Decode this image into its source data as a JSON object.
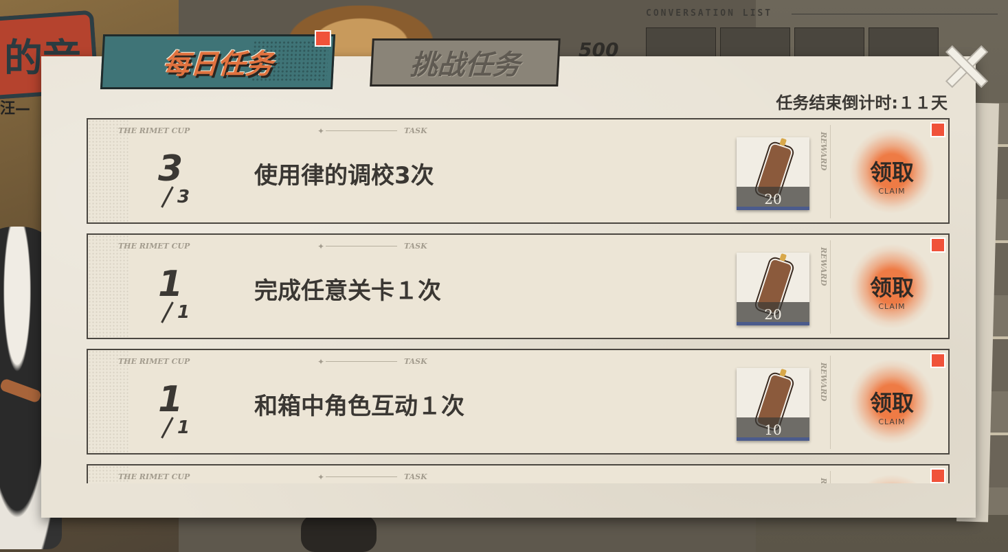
{
  "background": {
    "title_art_text": "的音",
    "side_text": "汪—",
    "conversation_label": "CONVERSATION LIST",
    "coin_value": "500"
  },
  "tabs": {
    "daily": "每日任务",
    "challenge": "挑战任务"
  },
  "countdown": "任务结束倒计时:１１天",
  "tasks": [
    {
      "series": "THE RIMET CUP",
      "tag": "TASK",
      "progress": "3",
      "total": "3",
      "desc": "使用律的调校3次",
      "reward_label": "REWARD",
      "reward_count": "20",
      "claim": "领取",
      "claim_en": "CLAIM"
    },
    {
      "series": "THE RIMET CUP",
      "tag": "TASK",
      "progress": "1",
      "total": "1",
      "desc": "完成任意关卡１次",
      "reward_label": "REWARD",
      "reward_count": "20",
      "claim": "领取",
      "claim_en": "CLAIM"
    },
    {
      "series": "THE RIMET CUP",
      "tag": "TASK",
      "progress": "1",
      "total": "1",
      "desc": "和箱中角色互动１次",
      "reward_label": "REWARD",
      "reward_count": "10",
      "claim": "领取",
      "claim_en": "CLAIM"
    },
    {
      "series": "THE RIMET CUP",
      "tag": "TASK",
      "reward_label": "R"
    }
  ],
  "colors": {
    "accent_orange": "#e0723f",
    "tab_teal": "#3f7477",
    "badge_red": "#f0523a",
    "reward_bar_blue": "#4b5b8c"
  }
}
